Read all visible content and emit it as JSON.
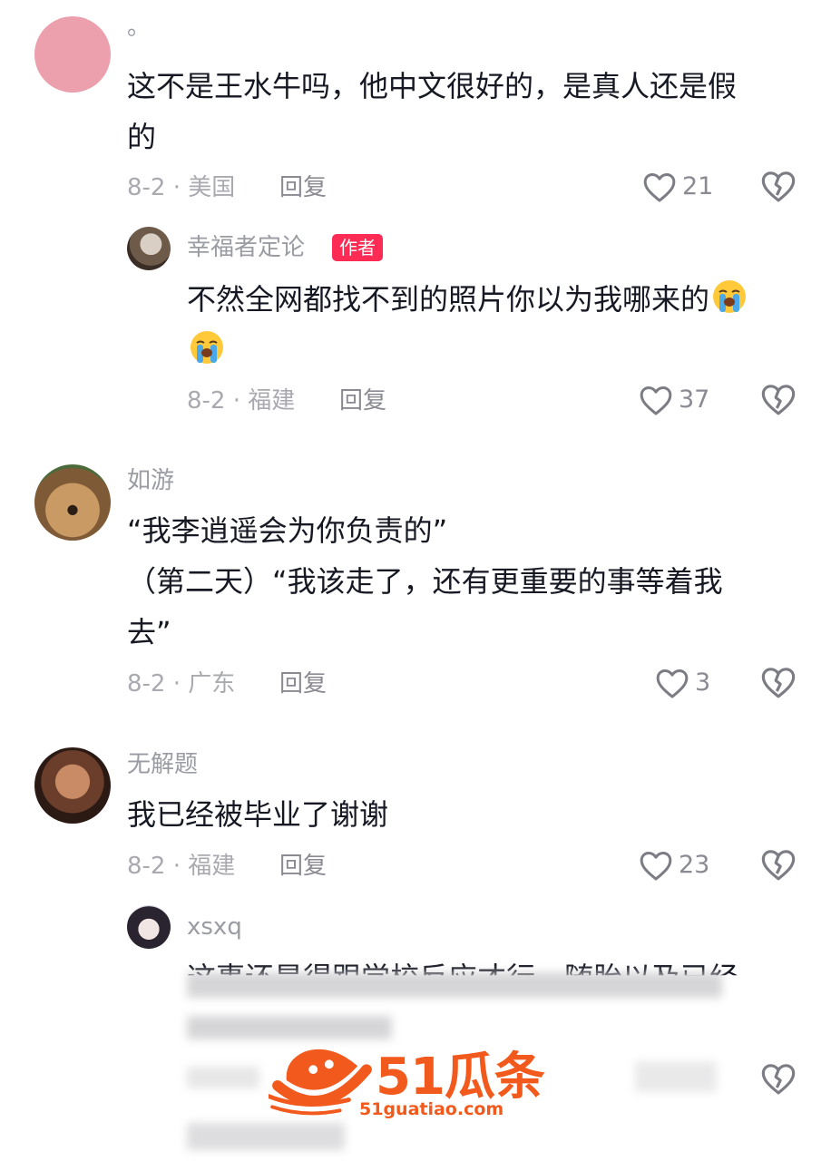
{
  "comments": [
    {
      "username": "。",
      "text": "这不是王水牛吗，他中文很好的，是真人还是假的",
      "text_lines": [
        "这不是王水牛吗，他中文很好的，是真人还是假",
        "的"
      ],
      "meta": "8-2 · 美国",
      "reply_label": "回复",
      "likes": "21",
      "replies": [
        {
          "username": "幸福者定论",
          "badge": "作者",
          "text_lines": [
            "不然全网都找不到的照片你以为我哪来的",
            ""
          ],
          "emoji": "loudly-crying-face",
          "meta": "8-2 · 福建",
          "reply_label": "回复",
          "likes": "37"
        }
      ]
    },
    {
      "username": "如游",
      "text_lines": [
        "“我李逍遥会为你负责的”",
        "（第二天）“我该走了，还有更重要的事等着我",
        "去”"
      ],
      "meta": "8-2 · 广东",
      "reply_label": "回复",
      "likes": "3"
    },
    {
      "username": "无解题",
      "text_lines": [
        "我已经被毕业了谢谢"
      ],
      "meta": "8-2 · 福建",
      "reply_label": "回复",
      "likes": "23",
      "replies": [
        {
          "username": "xsxq",
          "text_visible": "这事还是得跟学校反应才行，随胎以及已经"
        }
      ]
    }
  ],
  "watermark": {
    "brand": "51瓜条",
    "url": "51guatiao.com"
  },
  "colors": {
    "badge": "#fe2c55",
    "watermark": "#f25a1d",
    "muted_text": "#9a9ca3"
  },
  "icons": [
    "heart-outline-icon",
    "broken-heart-icon",
    "loudly-crying-face-emoji"
  ]
}
